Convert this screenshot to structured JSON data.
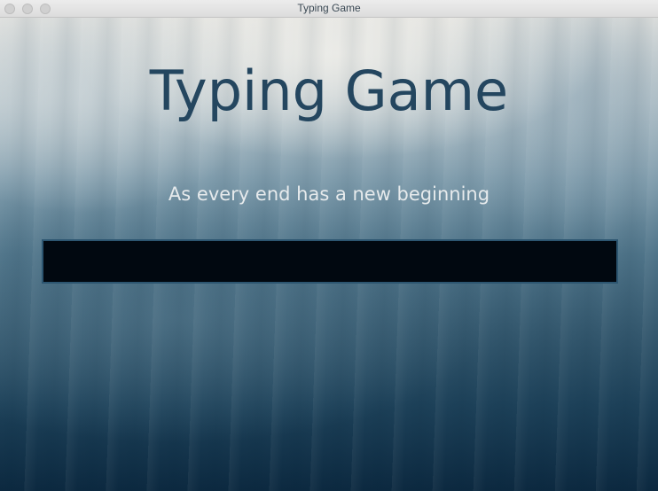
{
  "window": {
    "title": "Typing Game"
  },
  "game": {
    "heading": "Typing Game",
    "prompt": "As every end has a new beginning",
    "input_value": ""
  },
  "colors": {
    "heading": "#24465f",
    "prompt": "#e6eaec",
    "input_background": "#010810",
    "input_border": "#2c5570"
  }
}
